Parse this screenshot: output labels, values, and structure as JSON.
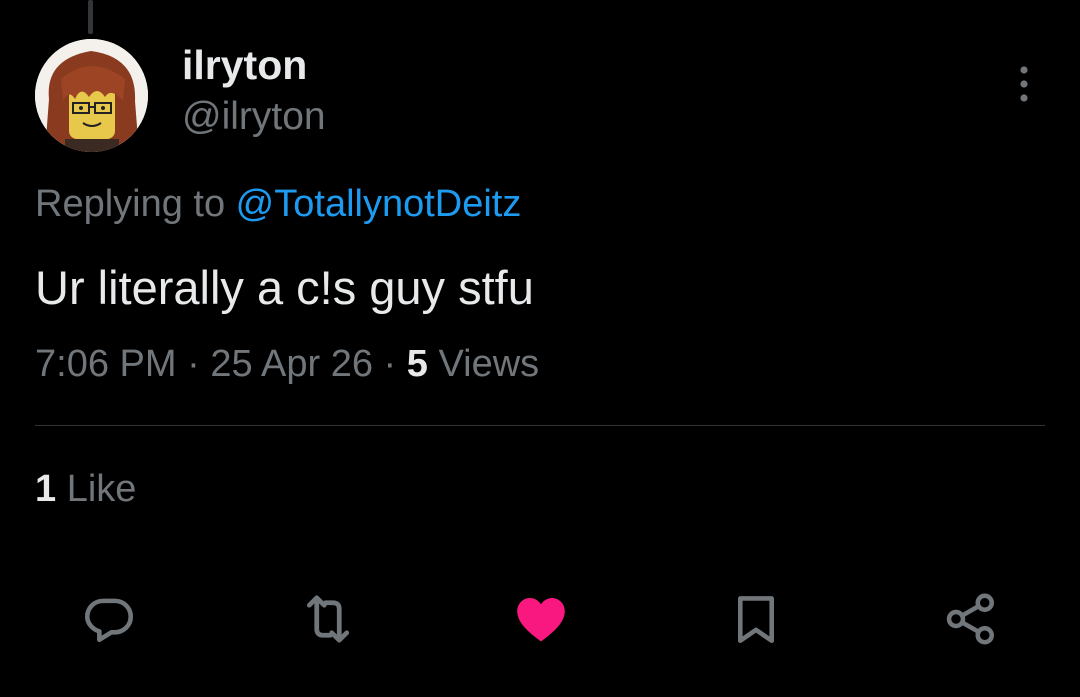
{
  "tweet": {
    "author": {
      "display_name": "ilryton",
      "handle": "@ilryton"
    },
    "replying_prefix": "Replying to ",
    "replying_to": "@TotallynotDeitz",
    "text": "Ur literally a c!s guy stfu",
    "time": "7:06 PM",
    "separator": " · ",
    "date": "25 Apr 26",
    "views_count": "5",
    "views_label": " Views",
    "likes_count": "1",
    "likes_label": " Like"
  },
  "actions": {
    "reply_icon": "reply-icon",
    "retweet_icon": "retweet-icon",
    "like_icon": "heart-icon",
    "bookmark_icon": "bookmark-icon",
    "share_icon": "share-icon"
  },
  "colors": {
    "background": "#000000",
    "text_primary": "#e7e9ea",
    "text_secondary": "#71767b",
    "link": "#1d9bf0",
    "like_active": "#f91880",
    "divider": "#2f3336"
  }
}
